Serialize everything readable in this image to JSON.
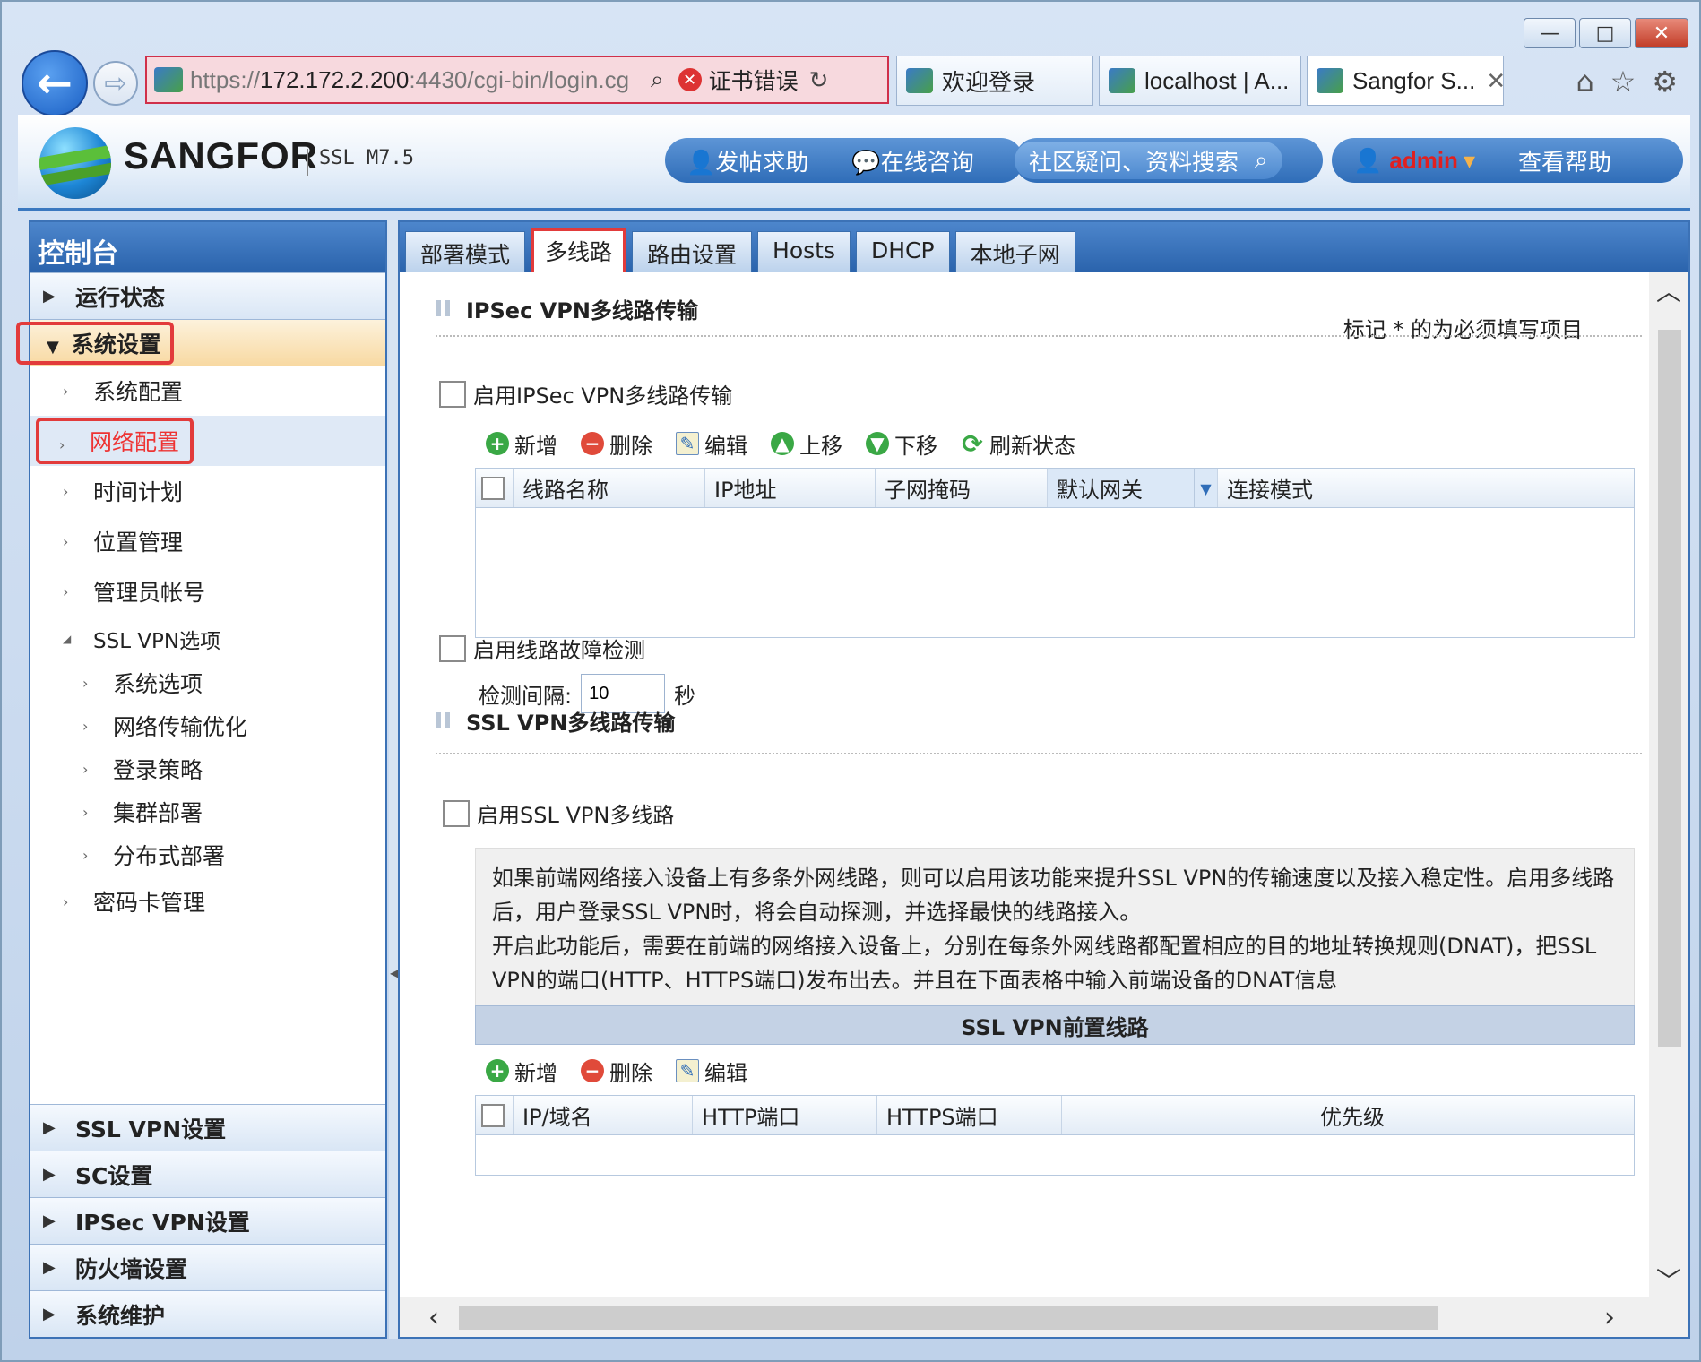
{
  "browser": {
    "url_prefix": "https://",
    "url_host": "172.172.2.200",
    "url_rest": ":4430/cgi-bin/login.cg",
    "cert_error": "证书错误",
    "tabs": [
      {
        "label": "欢迎登录"
      },
      {
        "label": "localhost | A..."
      },
      {
        "label": "Sangfor S..."
      }
    ],
    "window_controls": {
      "minimize": "—",
      "maximize": "□",
      "close": "✕"
    },
    "icons": {
      "back": "←",
      "forward": "⇨",
      "search": "⌕",
      "refresh": "↻",
      "home": "⌂",
      "favorites": "☆",
      "settings": "⚙"
    }
  },
  "header": {
    "brand": "SANGFOR",
    "version": "SSL M7.5",
    "help_post": "发帖求助",
    "online_consult": "在线咨询",
    "search_label": "社区疑问、资料搜索",
    "user": "admin",
    "view_help": "查看帮助"
  },
  "sidebar": {
    "title": "控制台",
    "groups_top": [
      {
        "label": "运行状态"
      },
      {
        "label": "系统设置"
      }
    ],
    "items": [
      {
        "label": "系统配置"
      },
      {
        "label": "网络配置"
      },
      {
        "label": "时间计划"
      },
      {
        "label": "位置管理"
      },
      {
        "label": "管理员帐号"
      },
      {
        "label": "SSL VPN选项"
      },
      {
        "label": "系统选项"
      },
      {
        "label": "网络传输优化"
      },
      {
        "label": "登录策略"
      },
      {
        "label": "集群部署"
      },
      {
        "label": "分布式部署"
      },
      {
        "label": "密码卡管理"
      }
    ],
    "groups_bottom": [
      {
        "label": "SSL VPN设置"
      },
      {
        "label": "SC设置"
      },
      {
        "label": "IPSec VPN设置"
      },
      {
        "label": "防火墙设置"
      },
      {
        "label": "系统维护"
      }
    ]
  },
  "main": {
    "tabs": [
      {
        "label": "部署模式"
      },
      {
        "label": "多线路"
      },
      {
        "label": "路由设置"
      },
      {
        "label": "Hosts"
      },
      {
        "label": "DHCP"
      },
      {
        "label": "本地子网"
      }
    ],
    "ipsec_section": {
      "title": "IPSec VPN多线路传输",
      "required_note": "标记 * 的为必须填写项目",
      "enable_label": "启用IPSec VPN多线路传输",
      "toolbar": {
        "add": "新增",
        "delete": "删除",
        "edit": "编辑",
        "up": "上移",
        "down": "下移",
        "refresh": "刷新状态"
      },
      "columns": [
        "线路名称",
        "IP地址",
        "子网掩码",
        "默认网关",
        "连接模式"
      ],
      "fault_detect_label": "启用线路故障检测",
      "interval_label": "检测间隔:",
      "interval_value": "10",
      "interval_unit": "秒"
    },
    "ssl_section": {
      "title": "SSL VPN多线路传输",
      "enable_label": "启用SSL VPN多线路",
      "desc_lines": [
        "如果前端网络接入设备上有多条外网线路，则可以启用该功能来提升SSL VPN的传输速度以及接入稳定性。启用多线路",
        "后，用户登录SSL VPN时，将会自动探测，并选择最快的线路接入。",
        "开启此功能后，需要在前端的网络接入设备上，分别在每条外网线路都配置相应的目的地址转换规则(DNAT)，把SSL",
        "VPN的端口(HTTP、HTTPS端口)发布出去。并且在下面表格中输入前端设备的DNAT信息"
      ],
      "frontline_title": "SSL VPN前置线路",
      "toolbar": {
        "add": "新增",
        "delete": "删除",
        "edit": "编辑"
      },
      "columns": [
        "IP/域名",
        "HTTP端口",
        "HTTPS端口",
        "优先级"
      ]
    }
  }
}
